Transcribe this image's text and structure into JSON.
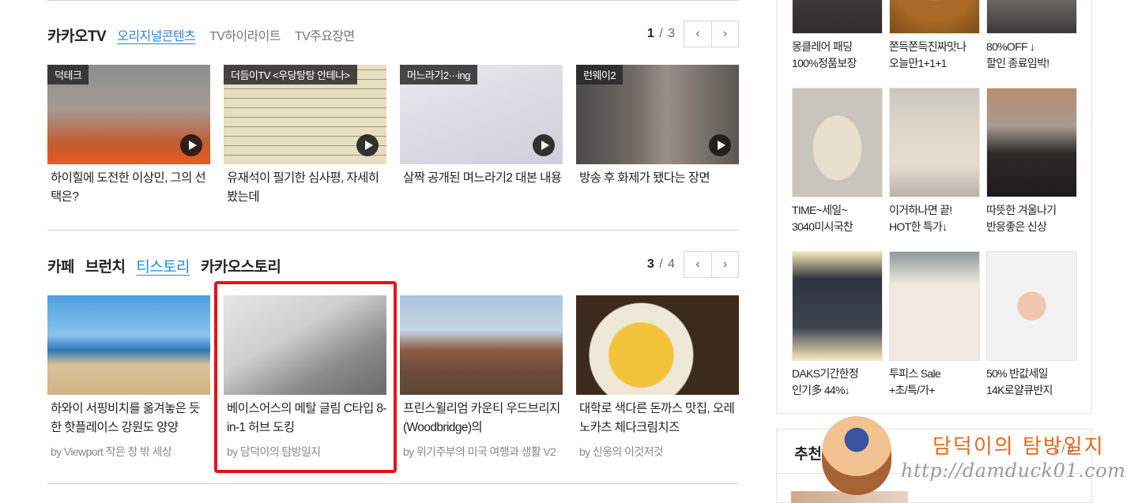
{
  "kakaotv": {
    "title": "카카오TV",
    "tabs": [
      "오리지널콘텐츠",
      "TV하이라이트",
      "TV주요장면"
    ],
    "page_current": "1",
    "page_total": "3",
    "cards": [
      {
        "badge": "덕테크",
        "title": "하이힐에 도전한 이상민, 그의 선택은?"
      },
      {
        "badge": "더듬이TV <우당탕탕 안테나>",
        "title": "유재석이 필기한 심사평, 자세히 봤는데"
      },
      {
        "badge": "머느라기2···ing",
        "title": "살짝 공개된 며느라기2 대본 내용"
      },
      {
        "badge": "런웨이2",
        "title": "방송 후 화제가 됐다는 장면"
      }
    ]
  },
  "blogs": {
    "tabs": [
      "카페",
      "브런치",
      "티스토리",
      "카카오스토리"
    ],
    "page_current": "3",
    "page_total": "4",
    "cards": [
      {
        "title": "하와이 서핑비치를 옮겨놓은 듯한 핫플레이스 강원도 양양",
        "by": "by Viewport 작은 창 밖 세상"
      },
      {
        "title": "베이스어스의 메탈 글림 C타입 8-in-1 허브 도킹",
        "by": "by 담덕이의 탐방일지"
      },
      {
        "title": "프린스윌리엄 카운티 우드브리지(Woodbridge)의",
        "by": "by 위기주부의 미국 여행과 생활 V2"
      },
      {
        "title": "대학로 색다른 돈까스 맛집, 오레노카츠 체다크림치즈",
        "by": "by 신웅의 이것저것"
      }
    ]
  },
  "shopping": {
    "items": [
      {
        "line1": "몽클레어 패딩",
        "line2": "100%정품보장"
      },
      {
        "line1": "쫀득쫀득진짜맛나",
        "line2": "오늘만1+1+1"
      },
      {
        "line1": "80%OFF ↓",
        "line2": "할인 종료임박!"
      },
      {
        "line1": "TIME~세일~",
        "line2": "3040미시국찬"
      },
      {
        "line1": "이거하나면 끝!",
        "line2": "HOT한 특가↓"
      },
      {
        "line1": "따뜻한 겨울나기",
        "line2": "반응좋은 신상"
      },
      {
        "line1": "DAKS기간한정",
        "line2": "인기多 44%↓"
      },
      {
        "line1": "투피스 Sale",
        "line2": "+초/특/가+"
      },
      {
        "line1": "50% 반값세일",
        "line2": "14K로얄큐반지"
      }
    ]
  },
  "recommend": {
    "title": "추천",
    "page": "1 / 6"
  },
  "watermark": {
    "name": "담덕이의 탐방일지",
    "url": "http://damduck01.com"
  },
  "icons": {
    "prev": "chevron-left-icon",
    "next": "chevron-right-icon",
    "play": "play-icon"
  },
  "colors": {
    "active_tab": "#2a86d6",
    "highlight": "#e8101a"
  }
}
